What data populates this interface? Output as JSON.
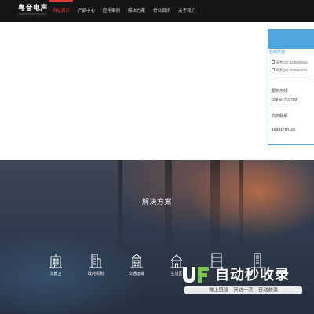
{
  "header": {
    "logo_cn": "粤音电声",
    "logo_en": "YUEYIN ELECTRONIC",
    "nav": [
      {
        "label": "网站首页",
        "active": true
      },
      {
        "label": "产品中心",
        "active": false
      },
      {
        "label": "应用案例",
        "active": false
      },
      {
        "label": "解决方案",
        "active": false
      },
      {
        "label": "行业资讯",
        "active": false
      },
      {
        "label": "关于我们",
        "active": false
      }
    ]
  },
  "service_panel": {
    "title": "在线交流",
    "qq": [
      "技术QQ:343936925",
      "商务QQ:283984932"
    ],
    "hotline_label": "服务热线:",
    "hotline": "028-84719789",
    "business_label": "商务联系:",
    "business_phone": "18981784165"
  },
  "solutions": {
    "title": "解决方案",
    "categories": [
      {
        "label": "文教卫",
        "icon": "school-building-icon"
      },
      {
        "label": "政府机构",
        "icon": "government-building-icon"
      },
      {
        "label": "交通运输",
        "icon": "transport-station-icon"
      },
      {
        "label": "生活区",
        "icon": "residential-house-icon"
      },
      {
        "label": "",
        "icon": "office-tower-icon"
      },
      {
        "label": "",
        "icon": "commercial-tower-icon"
      }
    ]
  },
  "watermark": {
    "title": "自动秒收录",
    "subtitle": "做上链接→来访一次→自动收录"
  },
  "colors": {
    "nav_bg": "#161616",
    "nav_active": "#e53935",
    "panel_accent": "#4fa6dc",
    "section_bg": "#2f3b4e"
  }
}
